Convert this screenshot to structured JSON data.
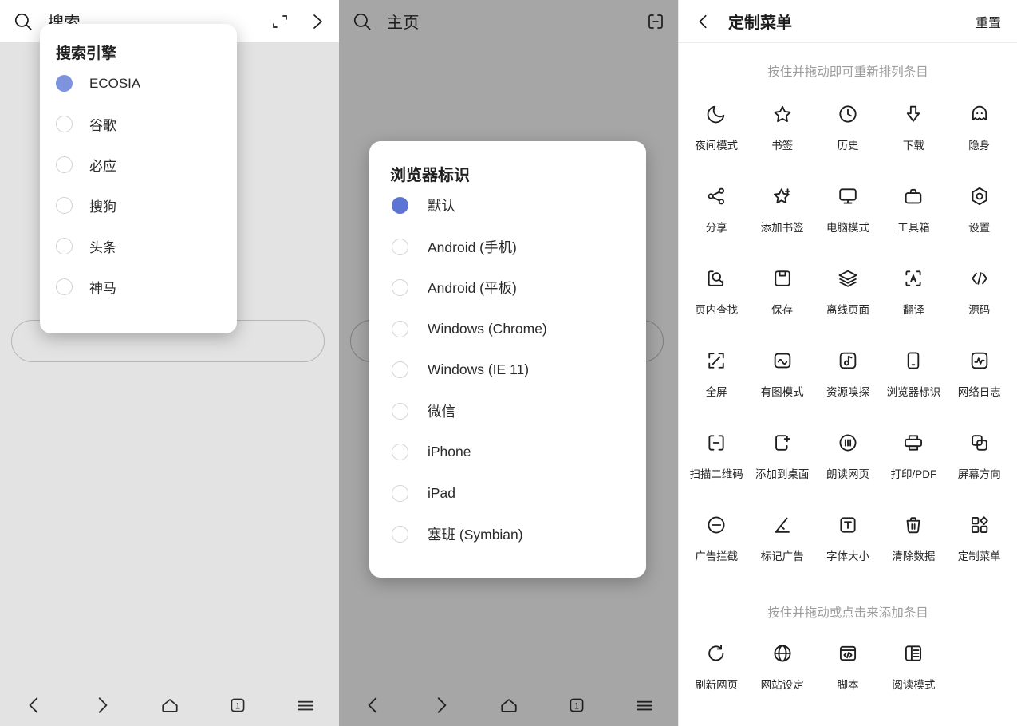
{
  "accent": {
    "engine_radio": "#7d93dd",
    "ua_radio": "#5c74d4"
  },
  "panel_search": {
    "topbar": {
      "title": "搜索",
      "search_icon": "search-icon",
      "scan_icon": "scan-frame-icon",
      "forward_icon": "chevron-right-icon"
    },
    "dialog": {
      "title": "搜索引擎",
      "options": [
        {
          "label": "ECOSIA",
          "selected": true
        },
        {
          "label": "谷歌",
          "selected": false
        },
        {
          "label": "必应",
          "selected": false
        },
        {
          "label": "搜狗",
          "selected": false
        },
        {
          "label": "头条",
          "selected": false
        },
        {
          "label": "神马",
          "selected": false
        }
      ]
    },
    "bottomnav": [
      {
        "name": "back",
        "icon": "chevron-left-icon"
      },
      {
        "name": "forward",
        "icon": "chevron-right-icon"
      },
      {
        "name": "home",
        "icon": "home-icon"
      },
      {
        "name": "tabs",
        "icon": "tab-count-icon",
        "count": "1"
      },
      {
        "name": "menu",
        "icon": "hamburger-icon"
      }
    ]
  },
  "panel_home": {
    "topbar": {
      "title": "主页",
      "search_icon": "search-icon",
      "scan_icon": "qr-scan-icon"
    },
    "dialog": {
      "title": "浏览器标识",
      "options": [
        {
          "label": "默认",
          "selected": true
        },
        {
          "label": "Android (手机)",
          "selected": false
        },
        {
          "label": "Android (平板)",
          "selected": false
        },
        {
          "label": "Windows (Chrome)",
          "selected": false
        },
        {
          "label": "Windows (IE 11)",
          "selected": false
        },
        {
          "label": "微信",
          "selected": false
        },
        {
          "label": "iPhone",
          "selected": false
        },
        {
          "label": "iPad",
          "selected": false
        },
        {
          "label": "塞班 (Symbian)",
          "selected": false
        }
      ]
    },
    "bottomnav": [
      {
        "name": "back",
        "icon": "chevron-left-icon"
      },
      {
        "name": "forward",
        "icon": "chevron-right-icon"
      },
      {
        "name": "home",
        "icon": "home-icon"
      },
      {
        "name": "tabs",
        "icon": "tab-count-icon",
        "count": "1"
      },
      {
        "name": "menu",
        "icon": "hamburger-icon"
      }
    ]
  },
  "panel_custom_menu": {
    "header": {
      "back_icon": "chevron-left-icon",
      "title": "定制菜单",
      "reset_label": "重置"
    },
    "hint_top": "按住并拖动即可重新排列条目",
    "hint_bottom": "按住并拖动或点击来添加条目",
    "active_items": [
      {
        "label": "夜间模式",
        "icon": "moon-icon"
      },
      {
        "label": "书签",
        "icon": "star-icon"
      },
      {
        "label": "历史",
        "icon": "clock-icon"
      },
      {
        "label": "下载",
        "icon": "download-arrow-icon"
      },
      {
        "label": "隐身",
        "icon": "ghost-incognito-icon"
      },
      {
        "label": "分享",
        "icon": "share-nodes-icon"
      },
      {
        "label": "添加书签",
        "icon": "star-plus-icon"
      },
      {
        "label": "电脑模式",
        "icon": "monitor-icon"
      },
      {
        "label": "工具箱",
        "icon": "toolbox-icon"
      },
      {
        "label": "设置",
        "icon": "hexagon-gear-icon"
      },
      {
        "label": "页内查找",
        "icon": "page-search-icon"
      },
      {
        "label": "保存",
        "icon": "floppy-save-icon"
      },
      {
        "label": "离线页面",
        "icon": "layers-icon"
      },
      {
        "label": "翻译",
        "icon": "translate-a-icon"
      },
      {
        "label": "源码",
        "icon": "code-brackets-icon"
      },
      {
        "label": "全屏",
        "icon": "fullscreen-icon"
      },
      {
        "label": "有图模式",
        "icon": "image-mode-icon"
      },
      {
        "label": "资源嗅探",
        "icon": "media-sniffer-icon"
      },
      {
        "label": "浏览器标识",
        "icon": "user-agent-phone-icon"
      },
      {
        "label": "网络日志",
        "icon": "network-log-icon"
      },
      {
        "label": "扫描二维码",
        "icon": "qr-scan-icon"
      },
      {
        "label": "添加到桌面",
        "icon": "add-to-desktop-icon"
      },
      {
        "label": "朗读网页",
        "icon": "read-aloud-icon"
      },
      {
        "label": "打印/PDF",
        "icon": "printer-icon"
      },
      {
        "label": "屏幕方向",
        "icon": "screen-rotate-icon"
      },
      {
        "label": "广告拦截",
        "icon": "adblock-icon"
      },
      {
        "label": "标记广告",
        "icon": "mark-ad-pen-icon"
      },
      {
        "label": "字体大小",
        "icon": "font-size-icon"
      },
      {
        "label": "清除数据",
        "icon": "trash-icon"
      },
      {
        "label": "定制菜单",
        "icon": "grid-customise-icon"
      }
    ],
    "available_items": [
      {
        "label": "刷新网页",
        "icon": "refresh-icon"
      },
      {
        "label": "网站设定",
        "icon": "globe-icon"
      },
      {
        "label": "脚本",
        "icon": "script-code-icon"
      },
      {
        "label": "阅读模式",
        "icon": "reader-mode-icon"
      }
    ]
  }
}
